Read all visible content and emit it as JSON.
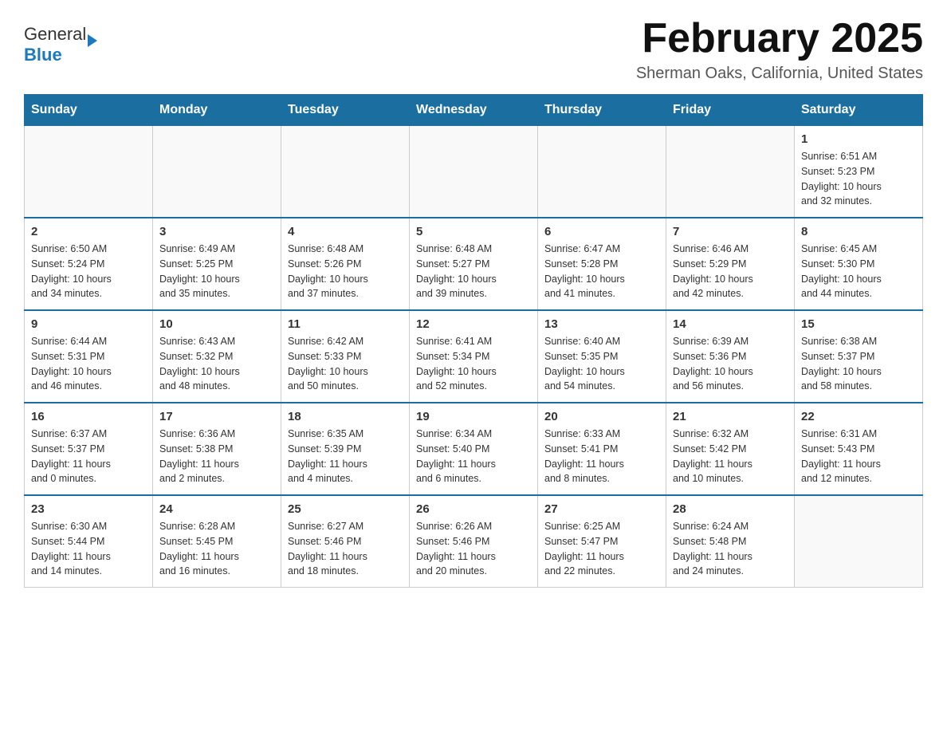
{
  "header": {
    "logo_general": "General",
    "logo_blue": "Blue",
    "month_title": "February 2025",
    "location": "Sherman Oaks, California, United States"
  },
  "days_of_week": [
    "Sunday",
    "Monday",
    "Tuesday",
    "Wednesday",
    "Thursday",
    "Friday",
    "Saturday"
  ],
  "weeks": [
    [
      {
        "day": "",
        "info": ""
      },
      {
        "day": "",
        "info": ""
      },
      {
        "day": "",
        "info": ""
      },
      {
        "day": "",
        "info": ""
      },
      {
        "day": "",
        "info": ""
      },
      {
        "day": "",
        "info": ""
      },
      {
        "day": "1",
        "info": "Sunrise: 6:51 AM\nSunset: 5:23 PM\nDaylight: 10 hours\nand 32 minutes."
      }
    ],
    [
      {
        "day": "2",
        "info": "Sunrise: 6:50 AM\nSunset: 5:24 PM\nDaylight: 10 hours\nand 34 minutes."
      },
      {
        "day": "3",
        "info": "Sunrise: 6:49 AM\nSunset: 5:25 PM\nDaylight: 10 hours\nand 35 minutes."
      },
      {
        "day": "4",
        "info": "Sunrise: 6:48 AM\nSunset: 5:26 PM\nDaylight: 10 hours\nand 37 minutes."
      },
      {
        "day": "5",
        "info": "Sunrise: 6:48 AM\nSunset: 5:27 PM\nDaylight: 10 hours\nand 39 minutes."
      },
      {
        "day": "6",
        "info": "Sunrise: 6:47 AM\nSunset: 5:28 PM\nDaylight: 10 hours\nand 41 minutes."
      },
      {
        "day": "7",
        "info": "Sunrise: 6:46 AM\nSunset: 5:29 PM\nDaylight: 10 hours\nand 42 minutes."
      },
      {
        "day": "8",
        "info": "Sunrise: 6:45 AM\nSunset: 5:30 PM\nDaylight: 10 hours\nand 44 minutes."
      }
    ],
    [
      {
        "day": "9",
        "info": "Sunrise: 6:44 AM\nSunset: 5:31 PM\nDaylight: 10 hours\nand 46 minutes."
      },
      {
        "day": "10",
        "info": "Sunrise: 6:43 AM\nSunset: 5:32 PM\nDaylight: 10 hours\nand 48 minutes."
      },
      {
        "day": "11",
        "info": "Sunrise: 6:42 AM\nSunset: 5:33 PM\nDaylight: 10 hours\nand 50 minutes."
      },
      {
        "day": "12",
        "info": "Sunrise: 6:41 AM\nSunset: 5:34 PM\nDaylight: 10 hours\nand 52 minutes."
      },
      {
        "day": "13",
        "info": "Sunrise: 6:40 AM\nSunset: 5:35 PM\nDaylight: 10 hours\nand 54 minutes."
      },
      {
        "day": "14",
        "info": "Sunrise: 6:39 AM\nSunset: 5:36 PM\nDaylight: 10 hours\nand 56 minutes."
      },
      {
        "day": "15",
        "info": "Sunrise: 6:38 AM\nSunset: 5:37 PM\nDaylight: 10 hours\nand 58 minutes."
      }
    ],
    [
      {
        "day": "16",
        "info": "Sunrise: 6:37 AM\nSunset: 5:37 PM\nDaylight: 11 hours\nand 0 minutes."
      },
      {
        "day": "17",
        "info": "Sunrise: 6:36 AM\nSunset: 5:38 PM\nDaylight: 11 hours\nand 2 minutes."
      },
      {
        "day": "18",
        "info": "Sunrise: 6:35 AM\nSunset: 5:39 PM\nDaylight: 11 hours\nand 4 minutes."
      },
      {
        "day": "19",
        "info": "Sunrise: 6:34 AM\nSunset: 5:40 PM\nDaylight: 11 hours\nand 6 minutes."
      },
      {
        "day": "20",
        "info": "Sunrise: 6:33 AM\nSunset: 5:41 PM\nDaylight: 11 hours\nand 8 minutes."
      },
      {
        "day": "21",
        "info": "Sunrise: 6:32 AM\nSunset: 5:42 PM\nDaylight: 11 hours\nand 10 minutes."
      },
      {
        "day": "22",
        "info": "Sunrise: 6:31 AM\nSunset: 5:43 PM\nDaylight: 11 hours\nand 12 minutes."
      }
    ],
    [
      {
        "day": "23",
        "info": "Sunrise: 6:30 AM\nSunset: 5:44 PM\nDaylight: 11 hours\nand 14 minutes."
      },
      {
        "day": "24",
        "info": "Sunrise: 6:28 AM\nSunset: 5:45 PM\nDaylight: 11 hours\nand 16 minutes."
      },
      {
        "day": "25",
        "info": "Sunrise: 6:27 AM\nSunset: 5:46 PM\nDaylight: 11 hours\nand 18 minutes."
      },
      {
        "day": "26",
        "info": "Sunrise: 6:26 AM\nSunset: 5:46 PM\nDaylight: 11 hours\nand 20 minutes."
      },
      {
        "day": "27",
        "info": "Sunrise: 6:25 AM\nSunset: 5:47 PM\nDaylight: 11 hours\nand 22 minutes."
      },
      {
        "day": "28",
        "info": "Sunrise: 6:24 AM\nSunset: 5:48 PM\nDaylight: 11 hours\nand 24 minutes."
      },
      {
        "day": "",
        "info": ""
      }
    ]
  ]
}
